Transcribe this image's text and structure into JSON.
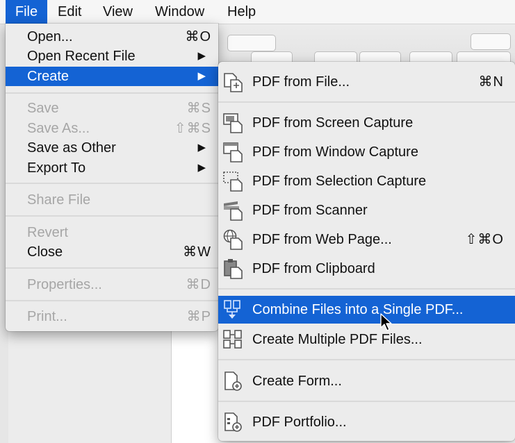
{
  "menubar": {
    "items": [
      {
        "label": "File"
      },
      {
        "label": "Edit"
      },
      {
        "label": "View"
      },
      {
        "label": "Window"
      },
      {
        "label": "Help"
      }
    ]
  },
  "file_menu": {
    "open": {
      "label": "Open...",
      "shortcut": "⌘O"
    },
    "open_recent": {
      "label": "Open Recent File",
      "arrow": "▶"
    },
    "create": {
      "label": "Create",
      "arrow": "▶"
    },
    "save": {
      "label": "Save",
      "shortcut": "⌘S"
    },
    "save_as": {
      "label": "Save As...",
      "shortcut": "⇧⌘S"
    },
    "save_as_other": {
      "label": "Save as Other",
      "arrow": "▶"
    },
    "export_to": {
      "label": "Export To",
      "arrow": "▶"
    },
    "share_file": {
      "label": "Share File"
    },
    "revert": {
      "label": "Revert"
    },
    "close": {
      "label": "Close",
      "shortcut": "⌘W"
    },
    "properties": {
      "label": "Properties...",
      "shortcut": "⌘D"
    },
    "print": {
      "label": "Print...",
      "shortcut": "⌘P"
    }
  },
  "create_menu": {
    "pdf_from_file": {
      "label": "PDF from File...",
      "shortcut": "⌘N",
      "icon": "file-icon"
    },
    "screen_capture": {
      "label": "PDF from Screen Capture",
      "icon": "screen-capture-icon"
    },
    "window_capture": {
      "label": "PDF from Window Capture",
      "icon": "window-capture-icon"
    },
    "selection_capture": {
      "label": "PDF from Selection Capture",
      "icon": "selection-capture-icon"
    },
    "scanner": {
      "label": "PDF from Scanner",
      "icon": "scanner-icon"
    },
    "web_page": {
      "label": "PDF from Web Page...",
      "shortcut": "⇧⌘O",
      "icon": "globe-icon"
    },
    "clipboard": {
      "label": "PDF from Clipboard",
      "icon": "clipboard-icon"
    },
    "combine": {
      "label": "Combine Files into a Single PDF...",
      "icon": "combine-icon"
    },
    "multiple": {
      "label": "Create Multiple PDF Files...",
      "icon": "multiple-files-icon"
    },
    "form": {
      "label": "Create Form...",
      "icon": "form-icon"
    },
    "portfolio": {
      "label": "PDF Portfolio...",
      "icon": "portfolio-icon"
    }
  },
  "colors": {
    "selection": "#1463d4",
    "menu_bg": "#ececec",
    "disabled_text": "#a6a6a6"
  }
}
